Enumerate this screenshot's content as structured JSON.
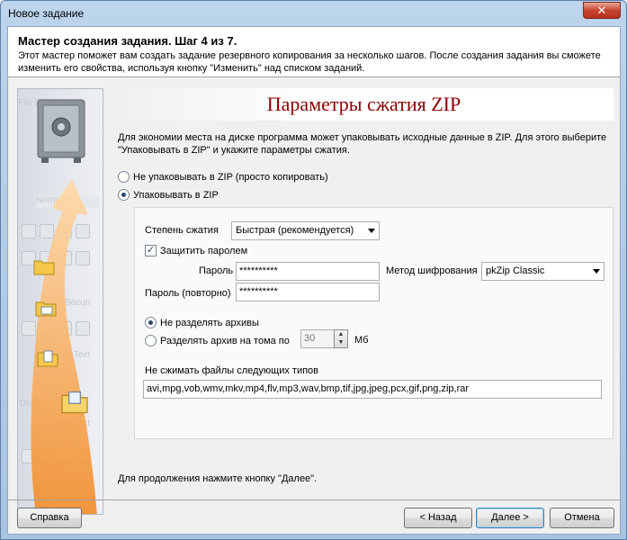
{
  "window": {
    "title": "Новое задание",
    "close_glyph": "✕"
  },
  "header": {
    "title": "Мастер создания задания.  Шаг 4 из 7.",
    "description": "Этот мастер поможет вам создать задание резервного копирования за несколько шагов. После создания задания вы сможете изменить его свойства, используя кнопку \"Изменить\" над списком заданий."
  },
  "page": {
    "title": "Параметры сжатия ZIP",
    "intro": "Для экономии места на диске программа может упаковывать исходные данные в ZIP. Для этого выберите \"Упаковывать в ZIP\" и укажите параметры сжатия."
  },
  "packing": {
    "no_pack_label": "Не упаковывать в ZIP (просто копировать)",
    "pack_label": "Упаковывать в ZIP",
    "selected": "pack"
  },
  "compression": {
    "level_label": "Степень сжатия",
    "level_value": "Быстрая (рекомендуется)",
    "protect_label": "Защитить паролем",
    "protect_checked": true,
    "check_glyph": "✓",
    "password_label": "Пароль",
    "password_value": "**********",
    "password_repeat_label": "Пароль (повторно)",
    "password_repeat_value": "**********",
    "encryption_label": "Метод шифрования",
    "encryption_value": "pkZip Classic"
  },
  "split": {
    "no_split_label": "Не разделять архивы",
    "split_label": "Разделять архив на тома по",
    "selected": "no_split",
    "volume_size": "30",
    "unit": "Мб"
  },
  "exclude": {
    "label": "Не сжимать файлы следующих типов",
    "value": "avi,mpg,vob,wmv,mkv,mp4,flv,mp3,wav,bmp,tif,jpg,jpeg,pcx,gif,png,zip,rar"
  },
  "footer": {
    "note": "Для продолжения нажмите кнопку \"Далее\".",
    "help": "Справка",
    "back": "< Назад",
    "next": "Далее >",
    "cancel": "Отмена"
  },
  "sidebar_ghost": {
    "menu": "File  Edit  View",
    "normal": "Normal",
    "securi": "Securi",
    "text": "Text",
    "draw": "Draw",
    "edit_text": "Edit Text",
    "securi2": "Securi"
  },
  "colors": {
    "page_title": "#8b0000",
    "arrow": "#f28c28",
    "titlebar": "#bcd4ec"
  }
}
